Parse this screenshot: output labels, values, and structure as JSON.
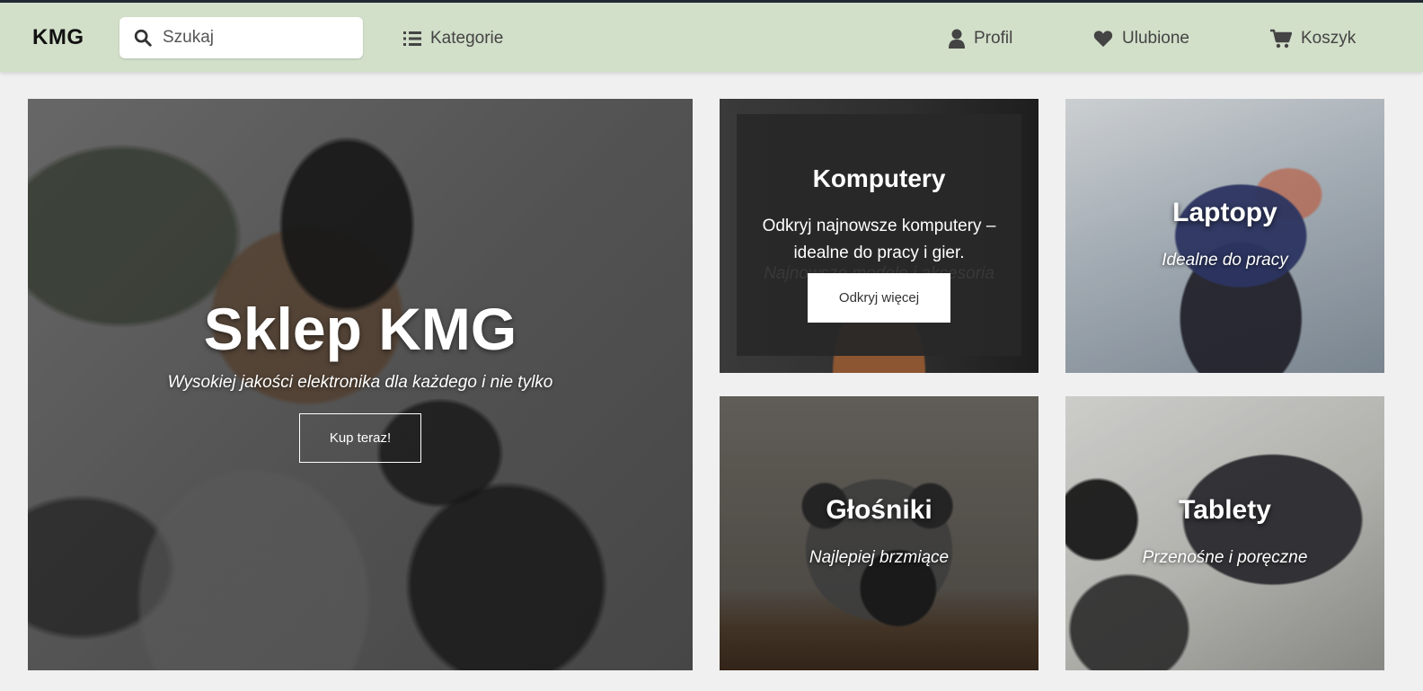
{
  "brand": {
    "logo": "KMG",
    "header_color": "#d2dfc9"
  },
  "search": {
    "placeholder": "Szukaj",
    "value": "",
    "icon": "search-icon"
  },
  "nav": {
    "categories": {
      "label": "Kategorie",
      "icon": "list-icon"
    },
    "profile": {
      "label": "Profil",
      "icon": "user-icon"
    },
    "favorites": {
      "label": "Ulubione",
      "icon": "heart-icon"
    },
    "cart": {
      "label": "Koszyk",
      "icon": "cart-icon"
    }
  },
  "hero": {
    "title": "Sklep KMG",
    "subtitle": "Wysokiej jakości elektronika dla każdego i nie tylko",
    "button": "Kup teraz!"
  },
  "tiles": {
    "computers": {
      "title": "Komputery",
      "description": "Odkryj najnowsze komputery – idealne do pracy i gier.",
      "faded_text": "Najnowsze modele i akcesoria",
      "button": "Odkryj więcej"
    },
    "laptops": {
      "title": "Laptopy",
      "subtitle": "Idealne do pracy"
    },
    "speakers": {
      "title": "Głośniki",
      "subtitle": "Najlepiej brzmiące"
    },
    "tablets": {
      "title": "Tablety",
      "subtitle": "Przenośne i poręczne"
    }
  }
}
